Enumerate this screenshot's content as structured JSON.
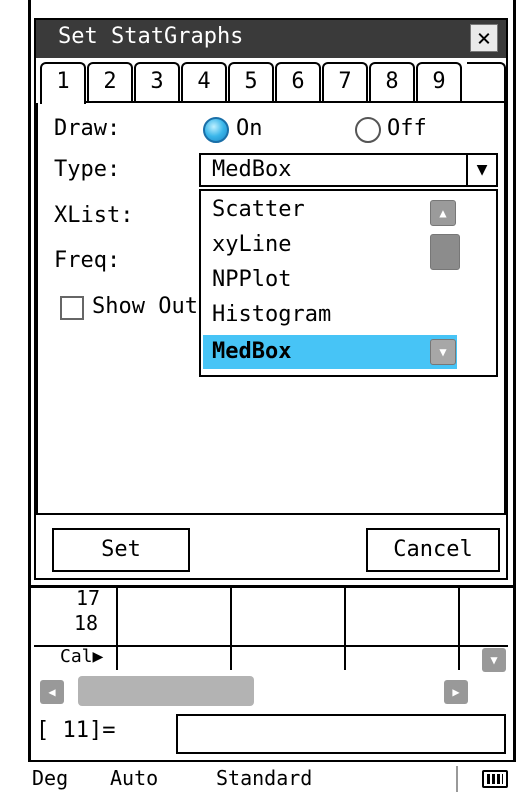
{
  "dialog": {
    "title": "Set StatGraphs",
    "close_symbol": "×",
    "tabs": [
      "1",
      "2",
      "3",
      "4",
      "5",
      "6",
      "7",
      "8",
      "9"
    ],
    "active_tab": "1",
    "draw": {
      "label": "Draw:",
      "on_label": "On",
      "off_label": "Off",
      "selected": "On"
    },
    "type": {
      "label": "Type:",
      "value": "MedBox",
      "arrow": "▼"
    },
    "xlist": {
      "label": "XList:"
    },
    "freq": {
      "label": "Freq:"
    },
    "show_outliers": {
      "label": "Show Outl",
      "checked": false
    },
    "dropdown_options": [
      "Scatter",
      "xyLine",
      "NPPlot",
      "Histogram",
      "MedBox"
    ],
    "selected_option": "MedBox",
    "buttons": {
      "set": "Set",
      "cancel": "Cancel"
    }
  },
  "spreadsheet": {
    "row_labels": [
      "17",
      "18"
    ],
    "cal_label": "Cal▶"
  },
  "entry": {
    "prompt": "[ 11]="
  },
  "status_bar": {
    "angle": "Deg",
    "mode": "Auto",
    "format": "Standard"
  },
  "colors": {
    "title_bar": "#3a3a3a",
    "selection": "#47c4f6",
    "radio_on": "#3ab6ea",
    "scroll_gray": "#999999"
  },
  "icons": {
    "close": "close-icon",
    "combo_arrow": "chevron-down-icon",
    "scroll_up": "arrow-up-icon",
    "scroll_down": "arrow-down-icon",
    "scroll_left": "arrow-left-icon",
    "scroll_right": "arrow-right-icon",
    "battery": "battery-icon"
  }
}
